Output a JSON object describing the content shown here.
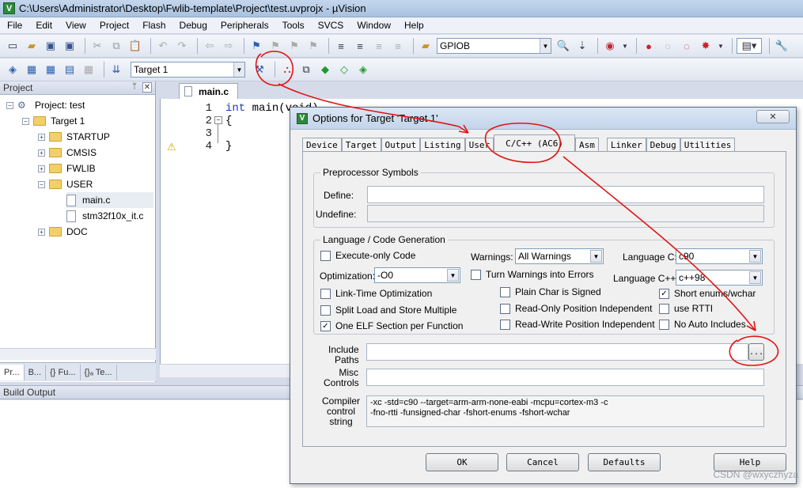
{
  "window": {
    "title": "C:\\Users\\Administrator\\Desktop\\Fwlib-template\\Project\\test.uvprojx - µVision",
    "app_icon": "V"
  },
  "menu": [
    "File",
    "Edit",
    "View",
    "Project",
    "Flash",
    "Debug",
    "Peripherals",
    "Tools",
    "SVCS",
    "Window",
    "Help"
  ],
  "toolbar": {
    "search_combo": "GPIOB",
    "target_combo": "Target 1"
  },
  "project_pane": {
    "title": "Project",
    "tree": [
      {
        "label": "Project: test"
      },
      {
        "label": "Target 1"
      },
      {
        "label": "STARTUP"
      },
      {
        "label": "CMSIS"
      },
      {
        "label": "FWLIB"
      },
      {
        "label": "USER"
      },
      {
        "label": "main.c"
      },
      {
        "label": "stm32f10x_it.c"
      },
      {
        "label": "DOC"
      }
    ],
    "tabs": [
      "Pr...",
      "B...",
      "{} Fu...",
      "{}ₐ Te..."
    ]
  },
  "editor": {
    "tab": "main.c",
    "lines": [
      {
        "n": "1",
        "kw": "int",
        "rest": " main(void)"
      },
      {
        "n": "2",
        "kw": "",
        "rest": "{"
      },
      {
        "n": "3",
        "kw": "",
        "rest": ""
      },
      {
        "n": "4",
        "kw": "",
        "rest": "}"
      }
    ]
  },
  "build_output": {
    "title": "Build Output"
  },
  "dialog": {
    "title": "Options for Target 'Target 1'",
    "close": "✕",
    "tabs": [
      "Device",
      "Target",
      "Output",
      "Listing",
      "User",
      "C/C++ (AC6)",
      "Asm",
      "Linker",
      "Debug",
      "Utilities"
    ],
    "preprocessor": {
      "title": "Preprocessor Symbols",
      "define_label": "Define:",
      "undefine_label": "Undefine:",
      "define_value": "",
      "undefine_value": ""
    },
    "language": {
      "title": "Language / Code Generation",
      "execute_only": "Execute-only Code",
      "warnings_label": "Warnings:",
      "warnings_value": "All Warnings",
      "lang_c_label": "Language C:",
      "lang_c_value": "c90",
      "optimization_label": "Optimization:",
      "optimization_value": "-O0",
      "turn_warnings": "Turn Warnings into Errors",
      "lang_cpp_label": "Language C++:",
      "lang_cpp_value": "c++98",
      "link_time": "Link-Time Optimization",
      "plain_char": "Plain Char is Signed",
      "short_enums": "Short enums/wchar",
      "split_load": "Split Load and Store Multiple",
      "ropi": "Read-Only Position Independent",
      "use_rtti": "use RTTI",
      "one_elf": "One ELF Section per Function",
      "rwpi": "Read-Write Position Independent",
      "no_auto": "No Auto Includes"
    },
    "include_paths_label": [
      "Include",
      "Paths"
    ],
    "include_paths_value": "",
    "browse": "...",
    "misc_label": [
      "Misc",
      "Controls"
    ],
    "misc_value": "",
    "compiler_label": [
      "Compiler",
      "control",
      "string"
    ],
    "compiler_string": [
      "-xc -std=c90 --target=arm-arm-none-eabi -mcpu=cortex-m3 -c",
      "-fno-rtti -funsigned-char -fshort-enums -fshort-wchar"
    ],
    "buttons": {
      "ok": "OK",
      "cancel": "Cancel",
      "defaults": "Defaults",
      "help": "Help"
    }
  },
  "watermark": "CSDN @wxyczhyza"
}
